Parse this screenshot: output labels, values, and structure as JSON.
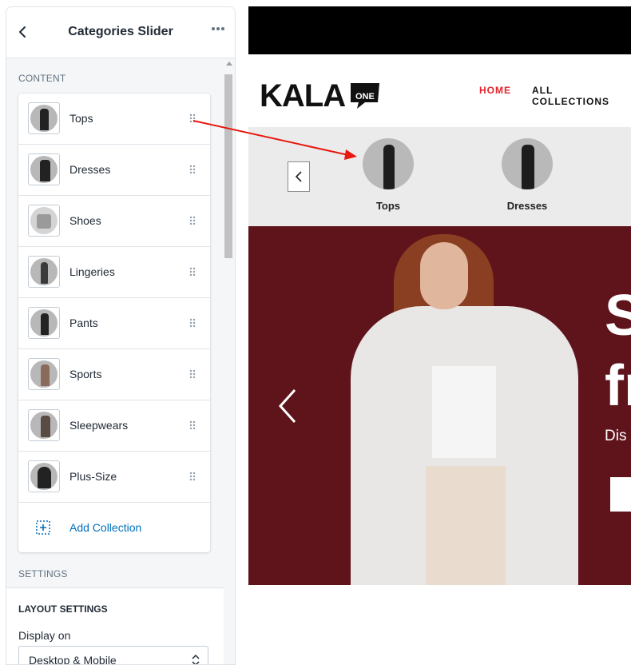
{
  "panel": {
    "title": "Categories Slider",
    "content_label": "CONTENT",
    "items": [
      {
        "label": "Tops"
      },
      {
        "label": "Dresses"
      },
      {
        "label": "Shoes"
      },
      {
        "label": "Lingeries"
      },
      {
        "label": "Pants"
      },
      {
        "label": "Sports"
      },
      {
        "label": "Sleepwears"
      },
      {
        "label": "Plus-Size"
      }
    ],
    "add_label": "Add Collection",
    "settings_label": "SETTINGS",
    "layout_title": "LAYOUT SETTINGS",
    "display_label": "Display on",
    "display_value": "Desktop & Mobile"
  },
  "preview": {
    "logo_text": "KALA",
    "logo_badge_text": "ONE",
    "nav": {
      "home": "HOME",
      "all": "ALL COLLECTIONS"
    },
    "categories": [
      {
        "label": "Tops"
      },
      {
        "label": "Dresses"
      }
    ],
    "hero": {
      "line1": "S",
      "line2": "fr",
      "line3": "Dis"
    },
    "accent_color": "#e0242d",
    "hero_color": "#5f141c"
  }
}
